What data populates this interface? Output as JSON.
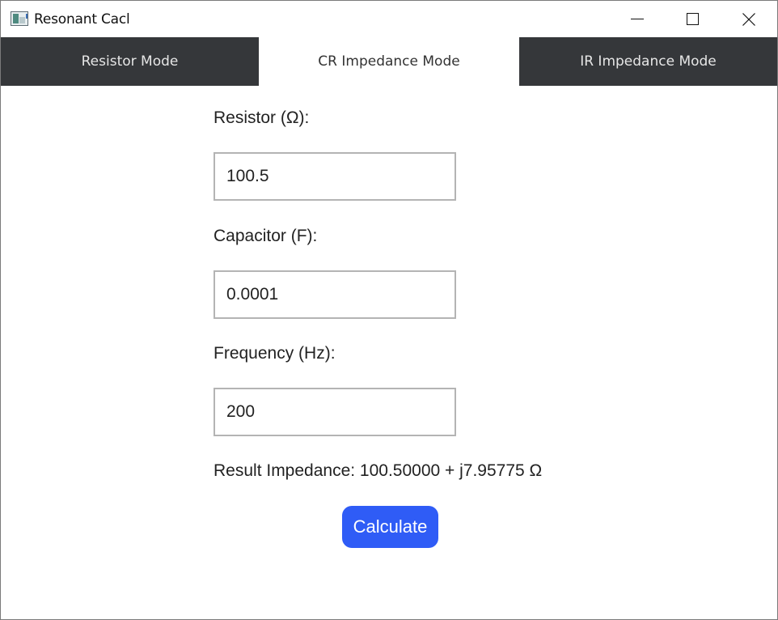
{
  "window": {
    "title": "Resonant Cacl",
    "icon": "app-chart-icon",
    "controls": [
      "minimize-icon",
      "maximize-icon",
      "close-icon"
    ]
  },
  "tabs": [
    {
      "label": "Resistor Mode",
      "active": false
    },
    {
      "label": "CR Impedance Mode",
      "active": true
    },
    {
      "label": "IR Impedance Mode",
      "active": false
    }
  ],
  "form": {
    "resistor": {
      "label": "Resistor (Ω):",
      "value": "100.5"
    },
    "capacitor": {
      "label": "Capacitor (F):",
      "value": "0.0001"
    },
    "frequency": {
      "label": "Frequency (Hz):",
      "value": "200"
    }
  },
  "result": {
    "text": "Result Impedance: 100.50000 + j7.95775 Ω"
  },
  "actions": {
    "calculate_label": "Calculate"
  },
  "colors": {
    "tab_dark": "#35373a",
    "accent_button": "#2f5cf6"
  }
}
